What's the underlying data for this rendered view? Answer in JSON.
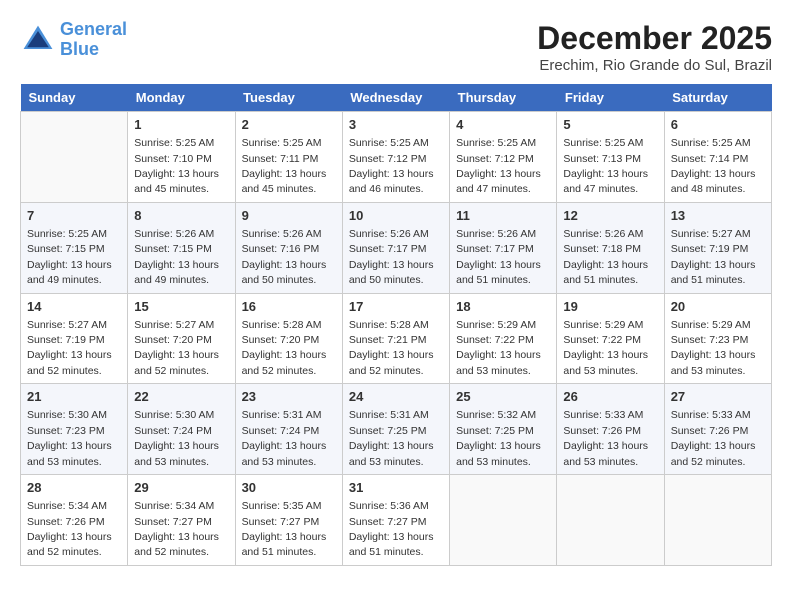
{
  "header": {
    "logo_line1": "General",
    "logo_line2": "Blue",
    "month_title": "December 2025",
    "location": "Erechim, Rio Grande do Sul, Brazil"
  },
  "weekdays": [
    "Sunday",
    "Monday",
    "Tuesday",
    "Wednesday",
    "Thursday",
    "Friday",
    "Saturday"
  ],
  "weeks": [
    [
      {
        "day": "",
        "empty": true
      },
      {
        "day": "1",
        "sunrise": "5:25 AM",
        "sunset": "7:10 PM",
        "daylight": "13 hours and 45 minutes."
      },
      {
        "day": "2",
        "sunrise": "5:25 AM",
        "sunset": "7:11 PM",
        "daylight": "13 hours and 45 minutes."
      },
      {
        "day": "3",
        "sunrise": "5:25 AM",
        "sunset": "7:12 PM",
        "daylight": "13 hours and 46 minutes."
      },
      {
        "day": "4",
        "sunrise": "5:25 AM",
        "sunset": "7:12 PM",
        "daylight": "13 hours and 47 minutes."
      },
      {
        "day": "5",
        "sunrise": "5:25 AM",
        "sunset": "7:13 PM",
        "daylight": "13 hours and 47 minutes."
      },
      {
        "day": "6",
        "sunrise": "5:25 AM",
        "sunset": "7:14 PM",
        "daylight": "13 hours and 48 minutes."
      }
    ],
    [
      {
        "day": "7",
        "sunrise": "5:25 AM",
        "sunset": "7:15 PM",
        "daylight": "13 hours and 49 minutes."
      },
      {
        "day": "8",
        "sunrise": "5:26 AM",
        "sunset": "7:15 PM",
        "daylight": "13 hours and 49 minutes."
      },
      {
        "day": "9",
        "sunrise": "5:26 AM",
        "sunset": "7:16 PM",
        "daylight": "13 hours and 50 minutes."
      },
      {
        "day": "10",
        "sunrise": "5:26 AM",
        "sunset": "7:17 PM",
        "daylight": "13 hours and 50 minutes."
      },
      {
        "day": "11",
        "sunrise": "5:26 AM",
        "sunset": "7:17 PM",
        "daylight": "13 hours and 51 minutes."
      },
      {
        "day": "12",
        "sunrise": "5:26 AM",
        "sunset": "7:18 PM",
        "daylight": "13 hours and 51 minutes."
      },
      {
        "day": "13",
        "sunrise": "5:27 AM",
        "sunset": "7:19 PM",
        "daylight": "13 hours and 51 minutes."
      }
    ],
    [
      {
        "day": "14",
        "sunrise": "5:27 AM",
        "sunset": "7:19 PM",
        "daylight": "13 hours and 52 minutes."
      },
      {
        "day": "15",
        "sunrise": "5:27 AM",
        "sunset": "7:20 PM",
        "daylight": "13 hours and 52 minutes."
      },
      {
        "day": "16",
        "sunrise": "5:28 AM",
        "sunset": "7:20 PM",
        "daylight": "13 hours and 52 minutes."
      },
      {
        "day": "17",
        "sunrise": "5:28 AM",
        "sunset": "7:21 PM",
        "daylight": "13 hours and 52 minutes."
      },
      {
        "day": "18",
        "sunrise": "5:29 AM",
        "sunset": "7:22 PM",
        "daylight": "13 hours and 53 minutes."
      },
      {
        "day": "19",
        "sunrise": "5:29 AM",
        "sunset": "7:22 PM",
        "daylight": "13 hours and 53 minutes."
      },
      {
        "day": "20",
        "sunrise": "5:29 AM",
        "sunset": "7:23 PM",
        "daylight": "13 hours and 53 minutes."
      }
    ],
    [
      {
        "day": "21",
        "sunrise": "5:30 AM",
        "sunset": "7:23 PM",
        "daylight": "13 hours and 53 minutes."
      },
      {
        "day": "22",
        "sunrise": "5:30 AM",
        "sunset": "7:24 PM",
        "daylight": "13 hours and 53 minutes."
      },
      {
        "day": "23",
        "sunrise": "5:31 AM",
        "sunset": "7:24 PM",
        "daylight": "13 hours and 53 minutes."
      },
      {
        "day": "24",
        "sunrise": "5:31 AM",
        "sunset": "7:25 PM",
        "daylight": "13 hours and 53 minutes."
      },
      {
        "day": "25",
        "sunrise": "5:32 AM",
        "sunset": "7:25 PM",
        "daylight": "13 hours and 53 minutes."
      },
      {
        "day": "26",
        "sunrise": "5:33 AM",
        "sunset": "7:26 PM",
        "daylight": "13 hours and 53 minutes."
      },
      {
        "day": "27",
        "sunrise": "5:33 AM",
        "sunset": "7:26 PM",
        "daylight": "13 hours and 52 minutes."
      }
    ],
    [
      {
        "day": "28",
        "sunrise": "5:34 AM",
        "sunset": "7:26 PM",
        "daylight": "13 hours and 52 minutes."
      },
      {
        "day": "29",
        "sunrise": "5:34 AM",
        "sunset": "7:27 PM",
        "daylight": "13 hours and 52 minutes."
      },
      {
        "day": "30",
        "sunrise": "5:35 AM",
        "sunset": "7:27 PM",
        "daylight": "13 hours and 51 minutes."
      },
      {
        "day": "31",
        "sunrise": "5:36 AM",
        "sunset": "7:27 PM",
        "daylight": "13 hours and 51 minutes."
      },
      {
        "day": "",
        "empty": true
      },
      {
        "day": "",
        "empty": true
      },
      {
        "day": "",
        "empty": true
      }
    ]
  ]
}
